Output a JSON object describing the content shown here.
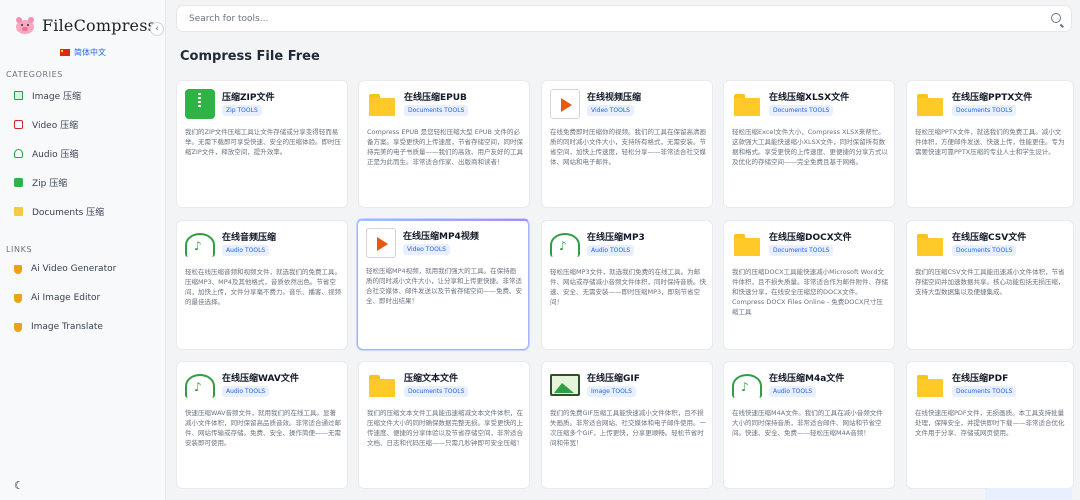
{
  "app": {
    "logo_text": "FileCompress",
    "language": "简体中文"
  },
  "sidebar": {
    "categories_title": "CATEGORIES",
    "categories": [
      {
        "label": "Image 压缩",
        "icon": "image-icon"
      },
      {
        "label": "Video 压缩",
        "icon": "video-icon"
      },
      {
        "label": "Audio 压缩",
        "icon": "audio-icon"
      },
      {
        "label": "Zip 压缩",
        "icon": "zip-icon"
      },
      {
        "label": "Documents 压缩",
        "icon": "folder-icon"
      }
    ],
    "links_title": "LINKS",
    "links": [
      {
        "label": "Ai Video Generator",
        "icon": "trophy-icon"
      },
      {
        "label": "Ai Image Editor",
        "icon": "trophy-icon"
      },
      {
        "label": "Image Translate",
        "icon": "trophy-icon"
      }
    ]
  },
  "search": {
    "placeholder": "Search for tools..."
  },
  "main": {
    "title": "Compress File Free"
  },
  "cards": [
    {
      "title": "压缩ZIP文件",
      "tag": "Zip TOOLS",
      "icon": "zip-icon",
      "desc": "我们的ZIP文件压缩工具让文件存储或分享变得轻而易举。无需下载即可享受快速、安全的压缩体验。即时压缩ZIP文件，释放空间，提升效率。"
    },
    {
      "title": "在线压缩EPUB",
      "tag": "Documents TOOLS",
      "icon": "folder-icon",
      "desc": "Compress EPUB 是您轻松压缩大型 EPUB 文件的必备方案。享受更快的上传速度，节省存储空间，同时保持完美的电子书质量——我们的高效、用户友好的工具正是为此而生。非常适合作家、出版商和读者！"
    },
    {
      "title": "在线视频压缩",
      "tag": "Video TOOLS",
      "icon": "video-icon",
      "desc": "在线免费即时压缩你的视频。我们的工具在保留高清画质的同时减小文件大小，支持所有格式，无需安装。节省空间，加快上传速度，轻松分享——非常适合社交媒体、网站和电子邮件。"
    },
    {
      "title": "在线压缩XLSX文件",
      "tag": "Documents TOOLS",
      "icon": "folder-icon",
      "desc": "轻松压缩Excel文件大小，Compress XLSX来帮忙。这款强大工具能快速缩小XLSX文件，同时保留所有数据和格式。享受更快的上传速度、更便捷的分享方式以及优化的存储空间——完全免费且基于网络。"
    },
    {
      "title": "在线压缩PPTX文件",
      "tag": "Documents TOOLS",
      "icon": "folder-icon",
      "desc": "轻松压缩PPTX文件，就选我们的免费工具。减小文件体积，方便邮件发送、快速上传，性能更佳。专为需要快速可靠PPTX压缩的专业人士和学生设计。"
    },
    {
      "title": "在线音频压缩",
      "tag": "Audio TOOLS",
      "icon": "audio-icon",
      "desc": "轻松在线压缩音频和视频文件，就选我们的免费工具。压缩MP3、MP4及其他格式，音质依然出色。节省空间，加快上传，文件分享毫不费力。音乐、播客、视频的最佳选择。"
    },
    {
      "title": "在线压缩MP4视频",
      "tag": "Video TOOLS",
      "icon": "video-icon",
      "desc": "轻松压缩MP4视频，就用我们强大的工具。在保持画质的同时减小文件大小，让分享和上传更快捷。非常适合社交媒体、邮件发送以及节省存储空间——免费、安全、即时出结果！"
    },
    {
      "title": "在线压缩MP3",
      "tag": "Audio TOOLS",
      "icon": "audio-icon",
      "desc": "轻松压缩MP3文件，就选我们免费的在线工具。为邮件、网站或存储减小音频文件体积，同时保持音质。快速、安全、无需安装——即时压缩MP3，即刻节省空间！"
    },
    {
      "title": "在线压缩DOCX文件",
      "tag": "Documents TOOLS",
      "icon": "folder-icon",
      "desc": "我们的压缩DOCX工具能快速减小Microsoft Word文件体积，且不损失质量。非常适合作为邮件附件、存储和快速分享，在线安全压缩您的DOCX文件。Compress DOCX Files Online - 免费DOCX尺寸压缩工具"
    },
    {
      "title": "在线压缩CSV文件",
      "tag": "Documents TOOLS",
      "icon": "folder-icon",
      "desc": "我们的压缩CSV文件工具能迅速减小文件体积，节省存储空间并加速数据共享。核心功能包括无损压缩，支持大型数据集以及便捷集成。"
    },
    {
      "title": "在线压缩WAV文件",
      "tag": "Audio TOOLS",
      "icon": "audio-icon",
      "desc": "快速压缩WAV音频文件，就用我们的在线工具。显著减小文件体积，同时保留高品质音效。非常适合通过邮件、网站传输或存储。免费、安全、操作简便——无需安装即可使用。"
    },
    {
      "title": "压缩文本文件",
      "tag": "Documents TOOLS",
      "icon": "folder-icon",
      "desc": "我们的压缩文本文件工具能迅速缩减文本文件体积，在压缩文件大小的同时确保数据完整无损。享受更快的上传速度、便捷的分享体验以及节省存储空间，非常适合文档、日志和代码压缩——只需几秒钟即可安全压缩！"
    },
    {
      "title": "在线压缩GIF",
      "tag": "Image TOOLS",
      "icon": "image-icon",
      "desc": "我们的免费GIF压缩工具能快速减小文件体积，且不损失画质。非常适合网站、社交媒体和电子邮件使用。一次压缩多个GIF，上传更快，分享更顺畅。轻松节省时间和带宽！"
    },
    {
      "title": "在线压缩M4a文件",
      "tag": "Audio TOOLS",
      "icon": "audio-icon",
      "desc": "在线快速压缩M4A文件。我们的工具在减小音频文件大小的同时保持音质，非常适合邮件、网站和节省空间。快速、安全、免费——轻松压缩M4A音频！"
    },
    {
      "title": "在线压缩PDF",
      "tag": "Documents TOOLS",
      "icon": "folder-icon",
      "desc": "在线快速压缩PDF文件，无损画质。本工具支持批量处理，保障安全，并提供即时下载——非常适合优化文件用于分享、存储或网页使用。"
    }
  ]
}
